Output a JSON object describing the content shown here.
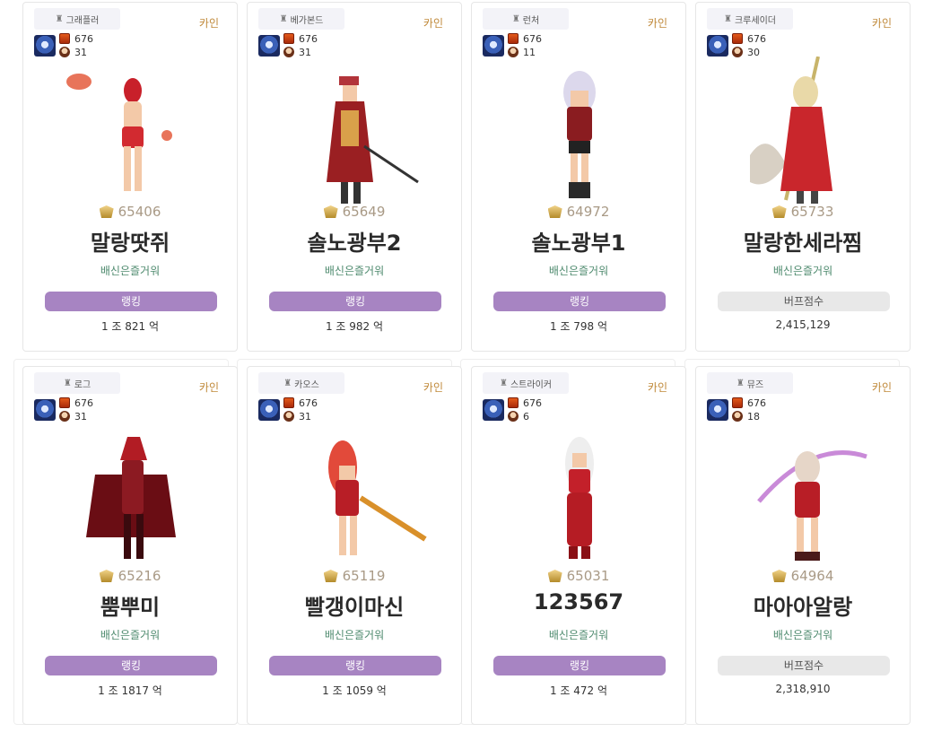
{
  "cards": [
    {
      "job": "그래플러",
      "server": "카인",
      "fame": "676",
      "pet_level": "31",
      "score": "65406",
      "name": "말랑땃쥐",
      "guild": "배신은즐거워",
      "button": "랭킹",
      "value": "1 조 821 억"
    },
    {
      "job": "베가본드",
      "server": "카인",
      "fame": "676",
      "pet_level": "31",
      "score": "65649",
      "name": "솔노광부2",
      "guild": "배신은즐거워",
      "button": "랭킹",
      "value": "1 조 982 억"
    },
    {
      "job": "런처",
      "server": "카인",
      "fame": "676",
      "pet_level": "11",
      "score": "64972",
      "name": "솔노광부1",
      "guild": "배신은즐거워",
      "button": "랭킹",
      "value": "1 조 798 억"
    },
    {
      "job": "크루세이더",
      "server": "카인",
      "fame": "676",
      "pet_level": "30",
      "score": "65733",
      "name": "말랑한세라찜",
      "guild": "배신은즐거워",
      "button": "버프점수",
      "value": "2,415,129"
    },
    {
      "job": "로그",
      "server": "카인",
      "fame": "676",
      "pet_level": "31",
      "score": "65216",
      "name": "뿜뿌미",
      "guild": "배신은즐거워",
      "button": "랭킹",
      "value": "1 조 1817 억"
    },
    {
      "job": "카오스",
      "server": "카인",
      "fame": "676",
      "pet_level": "31",
      "score": "65119",
      "name": "빨갱이마신",
      "guild": "배신은즐거워",
      "button": "랭킹",
      "value": "1 조 1059 억"
    },
    {
      "job": "스트라이커",
      "server": "카인",
      "fame": "676",
      "pet_level": "6",
      "score": "65031",
      "name": "123567",
      "guild": "배신은즐거워",
      "button": "랭킹",
      "value": "1 조 472 억"
    },
    {
      "job": "뮤즈",
      "server": "카인",
      "fame": "676",
      "pet_level": "18",
      "score": "64964",
      "name": "마아아알랑",
      "guild": "배신은즐거워",
      "button": "버프점수",
      "value": "2,318,910"
    }
  ],
  "colors": {
    "accent_purple": "#a784c2",
    "server_text": "#c0893a",
    "guild_text": "#4e8a6e",
    "score_text": "#a99a86"
  },
  "icons": {
    "job": "character-icon",
    "fame": "fame-icon",
    "score": "adventure-crest-icon"
  }
}
